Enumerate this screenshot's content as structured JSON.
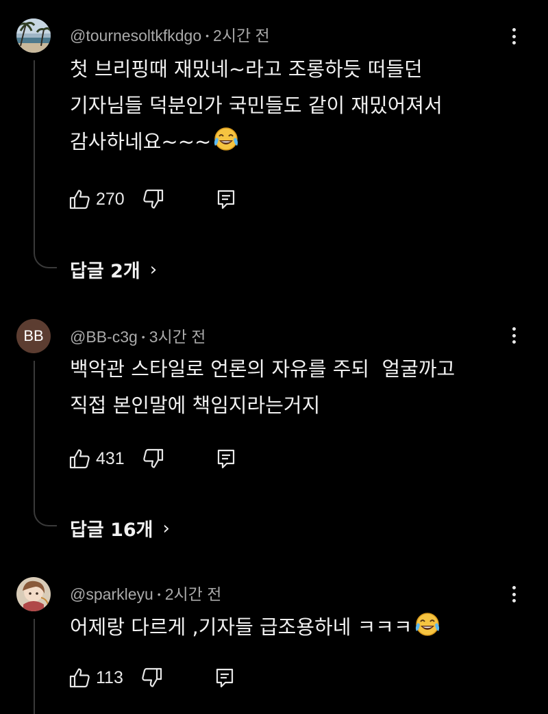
{
  "comments": [
    {
      "author": "@tournesoltkfkdgo",
      "time": "2시간 전",
      "lines": [
        "첫 브리핑때 재밌네~라고 조롱하듯 떠들던",
        "기자님들 덕분인가 국민들도 같이 재밌어져서",
        "감사하네요~~~"
      ],
      "emoji": "tears-of-joy-emoji",
      "likes": "270",
      "replies": "답글 2개",
      "avatar_icon": "beach-avatar-icon"
    },
    {
      "author": "@BB-c3g",
      "time": "3시간 전",
      "lines": [
        "백악관 스타일로 언론의 자유를 주되  얼굴까고",
        "직접 본인말에 책임지라는거지"
      ],
      "likes": "431",
      "replies": "답글 16개",
      "avatar_initials": "BB",
      "avatar_color": "#5c3d31"
    },
    {
      "author": "@sparkleyu",
      "time": "2시간 전",
      "lines": [
        "어제랑 다르게 ,기자들 급조용하네 ㅋㅋㅋ"
      ],
      "emoji": "tears-of-joy-emoji",
      "likes": "113",
      "avatar_icon": "anime-avatar-icon"
    }
  ],
  "icons": {
    "like": "thumbs-up-icon",
    "dislike": "thumbs-down-icon",
    "reply": "reply-comment-icon",
    "more": "more-vertical-icon",
    "chevron": "chevron-right-icon"
  },
  "colors": {
    "background": "#000000",
    "text": "#f1f1f1",
    "meta": "#aaaaaa",
    "thread": "#3a3a3a"
  },
  "chevron_glyph": "›"
}
